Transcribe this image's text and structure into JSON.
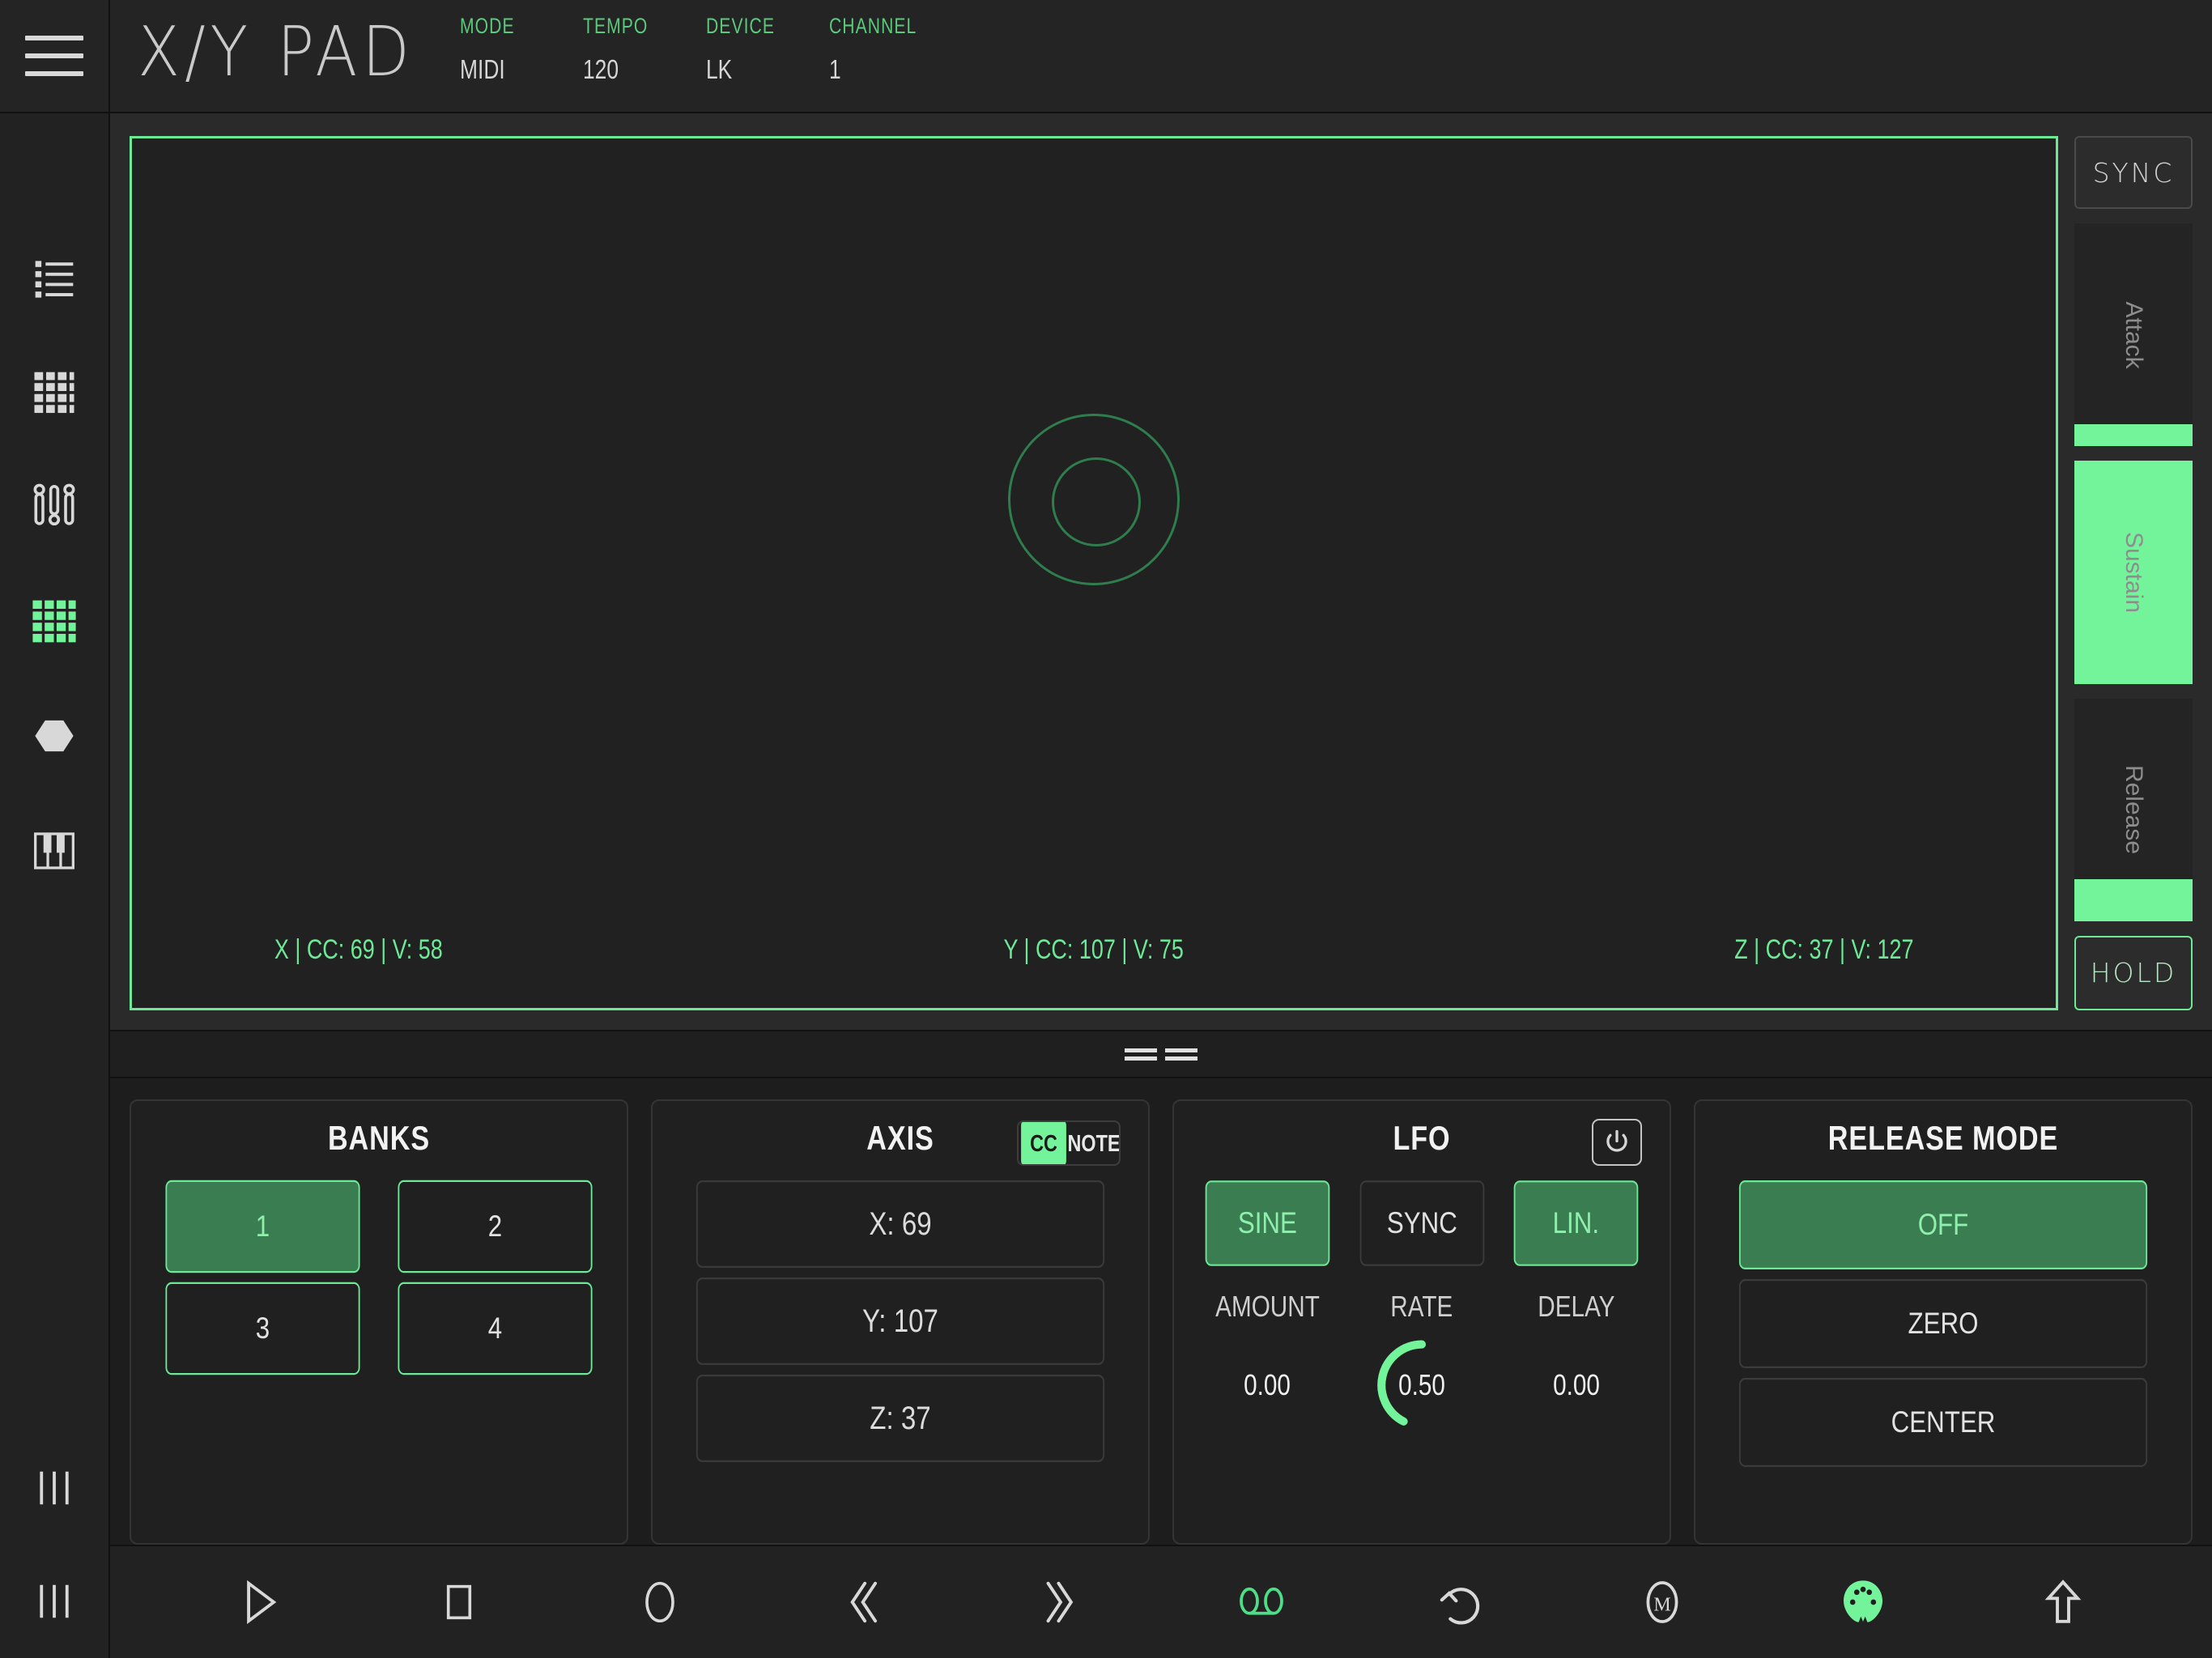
{
  "header": {
    "menu_icon": "hamburger-icon",
    "title": "X/Y PAD",
    "meta": [
      {
        "label": "MODE",
        "value": "MIDI"
      },
      {
        "label": "TEMPO",
        "value": "120"
      },
      {
        "label": "DEVICE",
        "value": "LK"
      },
      {
        "label": "CHANNEL",
        "value": "1"
      }
    ]
  },
  "sidebar": {
    "items": [
      {
        "name": "list-icon",
        "active": false
      },
      {
        "name": "grid-icon",
        "active": false
      },
      {
        "name": "sliders-icon",
        "active": false
      },
      {
        "name": "pad-grid-icon",
        "active": true
      },
      {
        "name": "hexagon-icon",
        "active": false
      },
      {
        "name": "piano-icon",
        "active": false
      }
    ],
    "footer_icon": "bars-icon"
  },
  "pad": {
    "readouts": {
      "x": "X | CC: 69 | V: 58",
      "y": "Y | CC: 107 | V: 75",
      "z": "Z | CC: 37 | V: 127"
    }
  },
  "right_strip": {
    "sync_label": "SYNC",
    "hold_label": "HOLD",
    "sliders": [
      {
        "label": "Attack",
        "fill_pct": 10
      },
      {
        "label": "Sustain",
        "fill_pct": 100
      },
      {
        "label": "Release",
        "fill_pct": 19
      }
    ]
  },
  "panels": {
    "banks": {
      "title": "BANKS",
      "buttons": [
        {
          "label": "1",
          "active": true
        },
        {
          "label": "2",
          "active": false
        },
        {
          "label": "3",
          "active": false
        },
        {
          "label": "4",
          "active": false
        }
      ]
    },
    "axis": {
      "title": "AXIS",
      "toggle": {
        "cc_label": "CC",
        "note_label": "NOTE",
        "selected": "CC"
      },
      "rows": [
        {
          "label": "X: 69"
        },
        {
          "label": "Y: 107"
        },
        {
          "label": "Z: 37"
        }
      ]
    },
    "lfo": {
      "title": "LFO",
      "power_icon": "power-icon",
      "modes": [
        {
          "label": "SINE",
          "active": true
        },
        {
          "label": "SYNC",
          "active": false
        },
        {
          "label": "LIN.",
          "active": true
        }
      ],
      "knobs": [
        {
          "label": "AMOUNT",
          "value": "0.00",
          "pct": 0
        },
        {
          "label": "RATE",
          "value": "0.50",
          "pct": 50
        },
        {
          "label": "DELAY",
          "value": "0.00",
          "pct": 0
        }
      ]
    },
    "release_mode": {
      "title": "RELEASE MODE",
      "options": [
        {
          "label": "OFF",
          "active": true
        },
        {
          "label": "ZERO",
          "active": false
        },
        {
          "label": "CENTER",
          "active": false
        }
      ]
    }
  },
  "transport": {
    "buttons": [
      {
        "name": "play-icon",
        "active": false
      },
      {
        "name": "stop-icon",
        "active": false
      },
      {
        "name": "record-icon",
        "active": false
      },
      {
        "name": "rewind-icon",
        "active": false
      },
      {
        "name": "fastforward-icon",
        "active": false
      },
      {
        "name": "loop-icon",
        "active": true
      },
      {
        "name": "undo-icon",
        "active": false
      },
      {
        "name": "metronome-icon",
        "active": false
      },
      {
        "name": "midi-din-icon",
        "active": true
      },
      {
        "name": "upload-icon",
        "active": false
      }
    ]
  },
  "colors": {
    "accent_bright": "#74f49a",
    "accent_mid": "#6de896",
    "accent_fill": "#3a7d51",
    "bg": "#1d1d1d",
    "panel_bg": "#202020"
  }
}
